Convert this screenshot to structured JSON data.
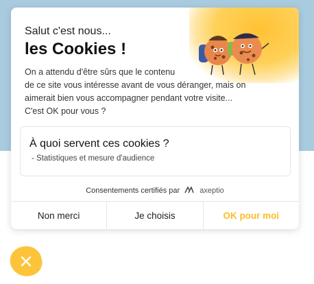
{
  "banner": {
    "title_small": "Salut c'est nous...",
    "title_big": "les Cookies !",
    "intro_lines": [
      "On a attendu d'être sûrs que le contenu",
      "de ce site vous intéresse avant de vous déranger, mais on",
      "aimerait bien vous accompagner pendant votre visite...",
      "C'est OK pour vous ?"
    ],
    "illustration_icon": "cookie-characters-icon"
  },
  "purpose": {
    "title": "À quoi servent ces cookies ?",
    "items": [
      "- Statistiques et mesure d'audience"
    ]
  },
  "certified": {
    "text": "Consentements certifiés par",
    "brand": "axeptio",
    "brand_icon": "axeptio-logo-icon"
  },
  "buttons": {
    "refuse": "Non merci",
    "choose": "Je choisis",
    "accept": "OK pour moi"
  },
  "close_icon": "close-icon",
  "colors": {
    "accent": "#fbbd26",
    "fab": "#fdc43b",
    "page_top": "#a9cbe0"
  }
}
